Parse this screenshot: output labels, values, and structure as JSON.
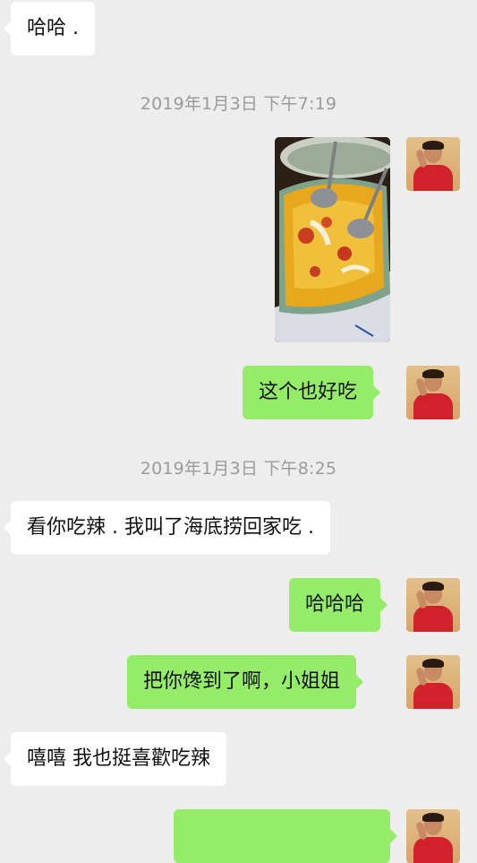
{
  "messages": [
    {
      "text": "哈哈 ."
    },
    {
      "timestamp": "2019年1月3日 下午7:19"
    },
    {
      "text": "这个也好吃"
    },
    {
      "timestamp": "2019年1月3日 下午8:25"
    },
    {
      "text": "看你吃辣 . 我叫了海底捞回家吃 ."
    },
    {
      "text": "哈哈哈"
    },
    {
      "text": "把你馋到了啊，小姐姐"
    },
    {
      "text": "嘻嘻 我也挺喜歡吃辣"
    }
  ],
  "colors": {
    "background": "#ededed",
    "incoming_bubble": "#ffffff",
    "outgoing_bubble": "#95ec69",
    "timestamp_text": "#9b9b9b"
  }
}
